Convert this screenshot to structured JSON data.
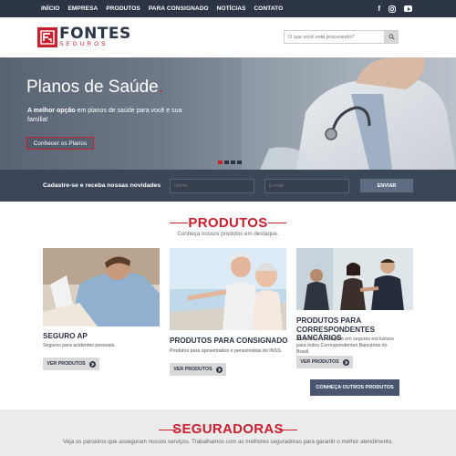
{
  "nav": {
    "items": [
      "INÍCIO",
      "EMPRESA",
      "PRODUTOS",
      "PARA CONSIGNADO",
      "NOTÍCIAS",
      "CONTATO"
    ],
    "social": [
      "facebook-icon",
      "instagram-icon",
      "youtube-icon"
    ]
  },
  "header": {
    "logo_name": "FONTES",
    "logo_sub": "SEGUROS",
    "search_placeholder": "O que você está procurando?"
  },
  "hero": {
    "title": "Planos de Saúde",
    "title_dot": ".",
    "subtitle_bold": "A melhor opção",
    "subtitle_rest": " em planos de saúde para você e sua família!",
    "button": "Conhecer os Planos",
    "slides": 4,
    "active_slide": 1
  },
  "newsletter": {
    "label": "Cadastre-se e receba nossas novidades",
    "name_placeholder": "Nome",
    "email_placeholder": "E-mail",
    "button": "ENVIAR"
  },
  "products": {
    "title": "PRODUTOS",
    "subtitle": "Conheça nossos produtos em destaque.",
    "items": [
      {
        "title": "SEGURO AP",
        "desc": "Seguros para acidentes pessoais.",
        "button": "VER PRODUTOS"
      },
      {
        "title": "PRODUTOS PARA CONSIGNADO",
        "desc": "Produtos para aposentados e pensionistas do INSS.",
        "button": "VER PRODUTOS"
      },
      {
        "title": "PRODUTOS PARA CORRESPONDENTES BANCÁRIOS",
        "desc": "As melhores soluções em seguros exclusivos para todos Correspondentes Bancários do Brasil.",
        "button": "VER PRODUTOS"
      }
    ],
    "more_button": "CONHEÇA OUTROS PRODUTOS"
  },
  "partners": {
    "title": "SEGURADORAS",
    "subtitle": "Veja os parceiros que asseguram nossos serviços. Trabalhamos com as melhores seguradoras para garantir o melhor atendimento."
  },
  "colors": {
    "brand_red": "#c8202f",
    "navy": "#2b3545",
    "news_bg": "#3b4658"
  }
}
